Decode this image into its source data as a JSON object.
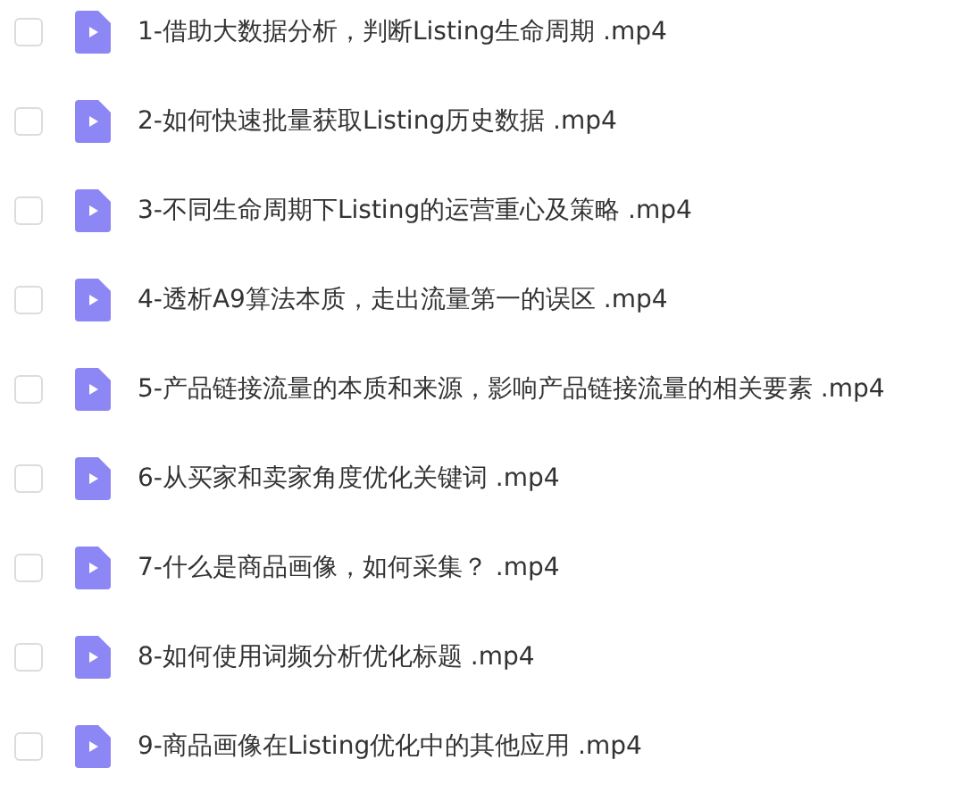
{
  "files": [
    {
      "name": "1-借助大数据分析，判断Listing生命周期 .mp4",
      "checked": false
    },
    {
      "name": "2-如何快速批量获取Listing历史数据 .mp4",
      "checked": false
    },
    {
      "name": "3-不同生命周期下Listing的运营重心及策略 .mp4",
      "checked": false
    },
    {
      "name": "4-透析A9算法本质，走出流量第一的误区 .mp4",
      "checked": false
    },
    {
      "name": "5-产品链接流量的本质和来源，影响产品链接流量的相关要素 .mp4",
      "checked": false
    },
    {
      "name": "6-从买家和卖家角度优化关键词 .mp4",
      "checked": false
    },
    {
      "name": "7-什么是商品画像，如何采集？ .mp4",
      "checked": false
    },
    {
      "name": "8-如何使用词频分析优化标题 .mp4",
      "checked": false
    },
    {
      "name": "9-商品画像在Listing优化中的其他应用 .mp4",
      "checked": false
    }
  ]
}
